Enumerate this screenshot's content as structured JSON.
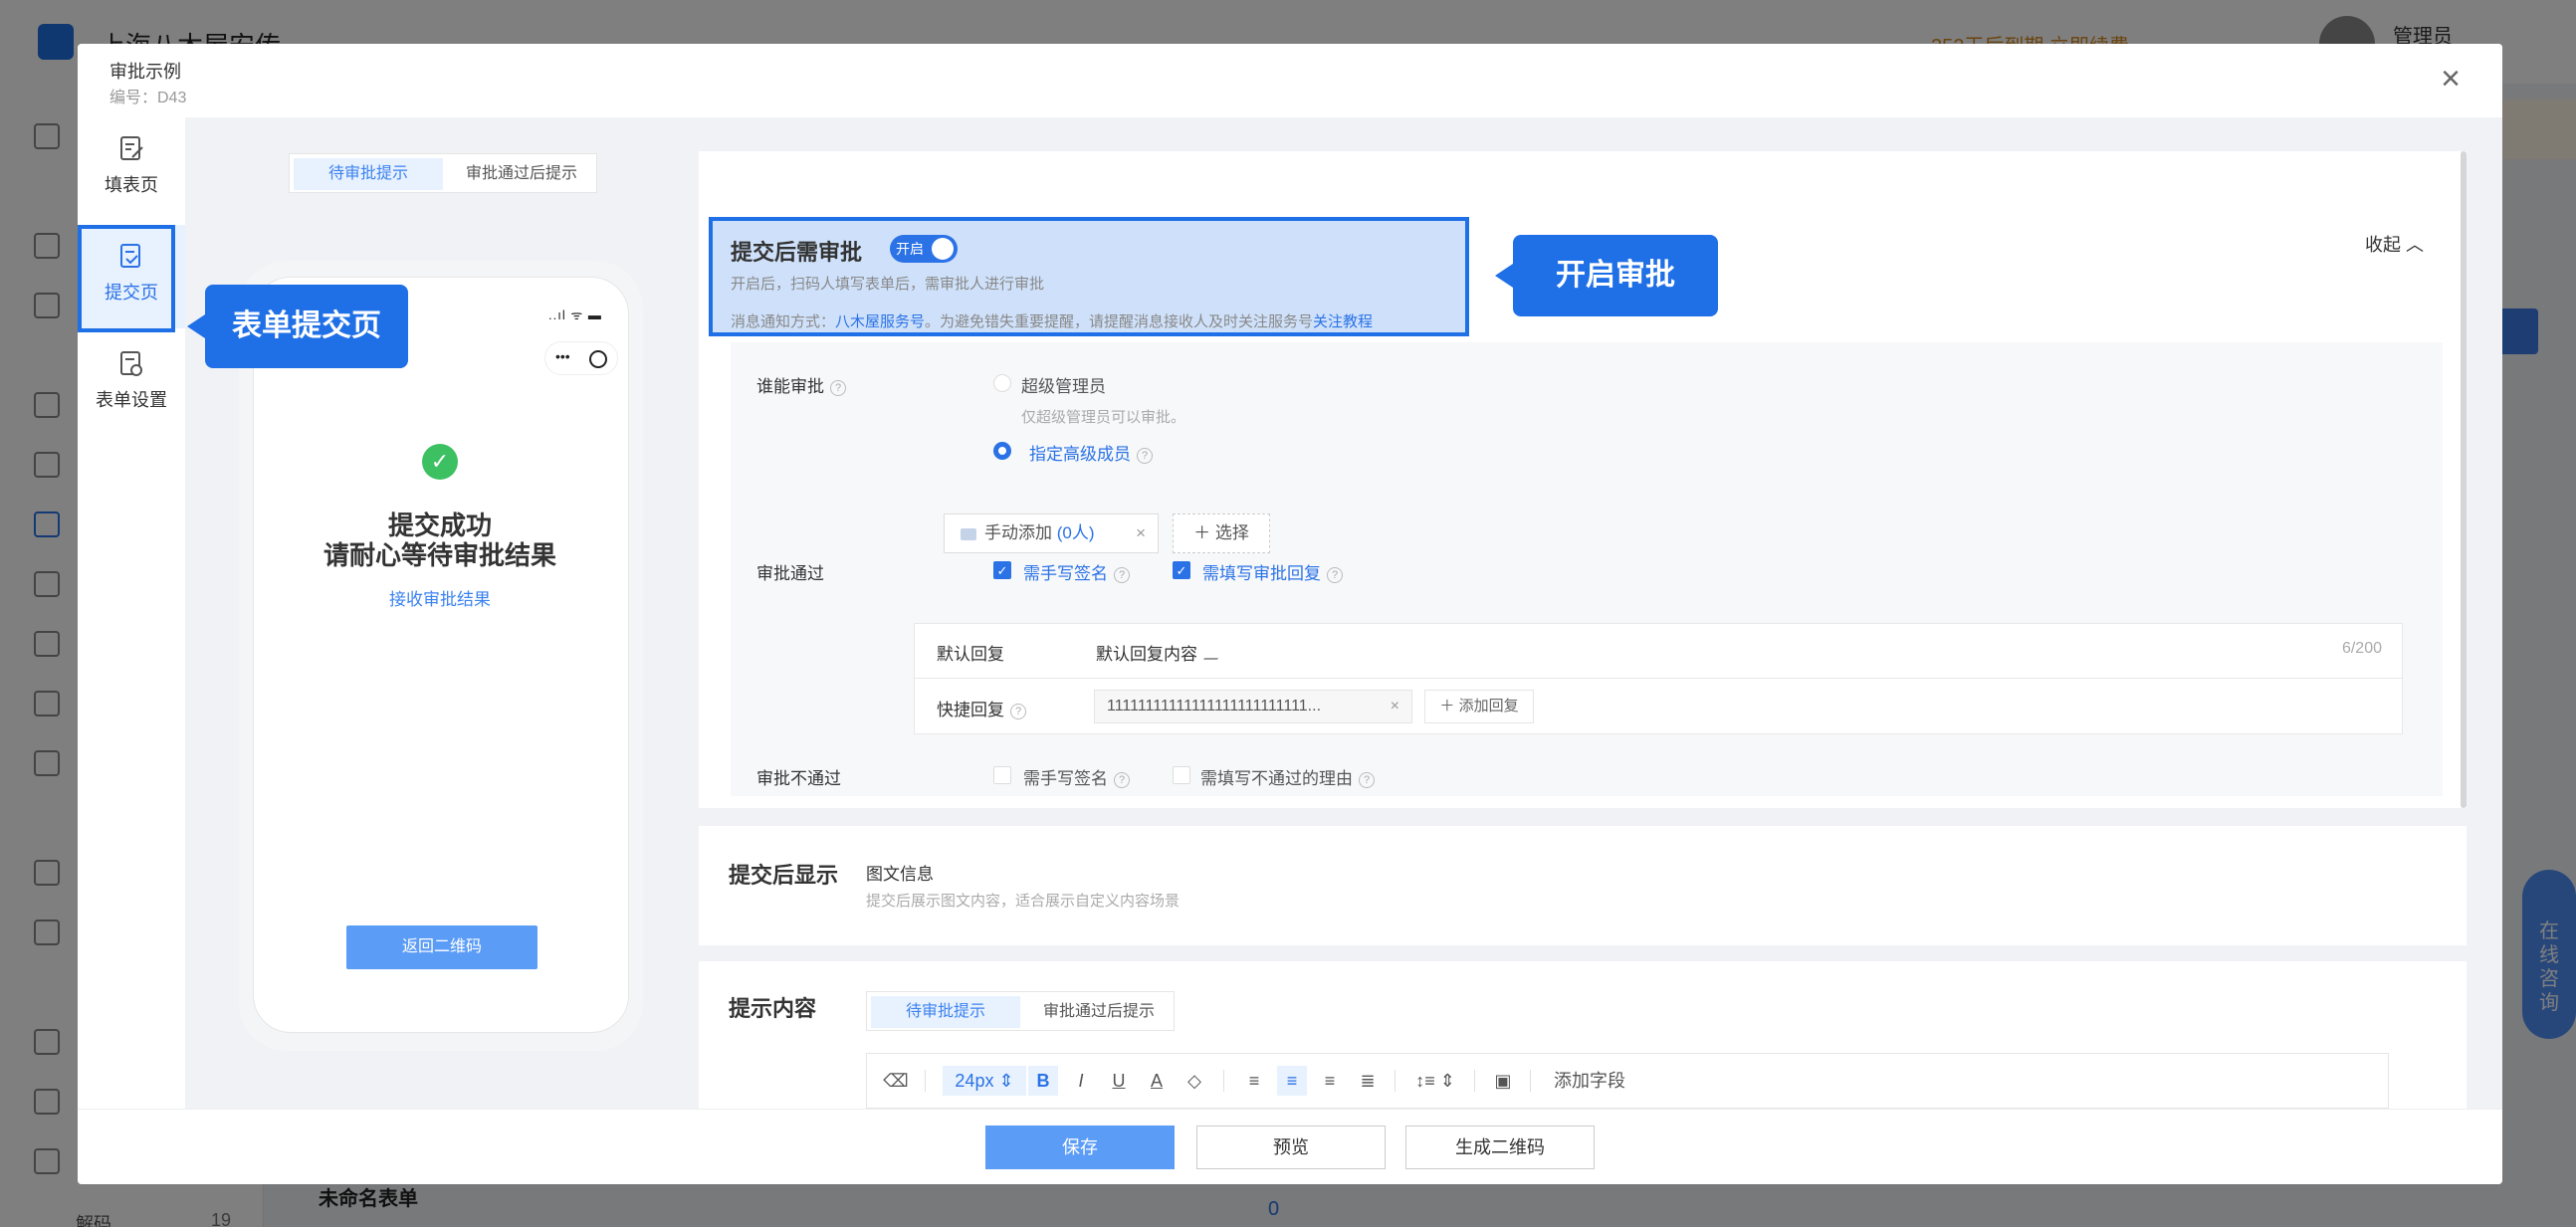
{
  "background": {
    "company": "上海八木屋安传",
    "trial_notice": "352天后到期   立即续费",
    "user": "管理员",
    "consult": "在线咨询",
    "bottom_form_name": "未命名表单",
    "bottom_count": "0",
    "bottom_code": "解码",
    "bottom_num": "19"
  },
  "modal": {
    "title": "审批示例",
    "subtitle": "编号：D43",
    "close_icon": "close-icon"
  },
  "left_nav": [
    {
      "label": "填表页",
      "icon": "form-edit-icon",
      "active": false
    },
    {
      "label": "提交页",
      "icon": "submit-check-icon",
      "active": true
    },
    {
      "label": "表单设置",
      "icon": "form-settings-icon",
      "active": false
    }
  ],
  "callouts": {
    "form_submit": "表单提交页",
    "approval_on": "开启审批"
  },
  "preview": {
    "tabs": [
      "待审批提示",
      "审批通过后提示"
    ],
    "status": "..ıl ᯤ ▬",
    "success_line1": "提交成功",
    "success_line2": "请耐心等待审批结果",
    "result_link": "接收审批结果",
    "back_button": "返回二维码"
  },
  "approval": {
    "title": "提交后需审批",
    "toggle_label": "开启",
    "toggle_on": true,
    "desc": "开启后，扫码人填写表单后，需审批人进行审批",
    "notice_prefix": "消息通知方式：",
    "notice_link1": "八木屋服务号",
    "notice_mid": "。为避免错失重要提醒，请提醒消息接收人及时关注服务号",
    "notice_link2": "关注教程",
    "collapse": "收起"
  },
  "who": {
    "label": "谁能审批",
    "option1": "超级管理员",
    "option1_sub": "仅超级管理员可以审批。",
    "option2": "指定高级成员",
    "tag_label": "手动添加",
    "tag_count": "(0人)",
    "select_button": "选择"
  },
  "pass": {
    "label": "审批通过",
    "check1": "需手写签名",
    "check2": "需填写审批回复",
    "default_reply_label": "默认回复",
    "default_reply_value": "默认回复内容",
    "default_reply_count": "6/200",
    "quick_reply_label": "快捷回复",
    "quick_reply_value": "11111111111111111111111111...",
    "add_reply": "添加回复"
  },
  "reject": {
    "label": "审批不通过",
    "check1": "需手写签名",
    "check2": "需填写不通过的理由"
  },
  "after_display": {
    "title": "提交后显示",
    "main": "图文信息",
    "sub": "提交后展示图文内容，适合展示自定义内容场景"
  },
  "tip_content": {
    "title": "提示内容",
    "tabs": [
      "待审批提示",
      "审批通过后提示"
    ],
    "font_size": "24px",
    "add_field": "添加字段"
  },
  "footer": {
    "save": "保存",
    "preview": "预览",
    "qrcode": "生成二维码"
  },
  "colors": {
    "primary": "#2a72e6",
    "highlight": "#1f6fe6",
    "success": "#3cc062"
  }
}
